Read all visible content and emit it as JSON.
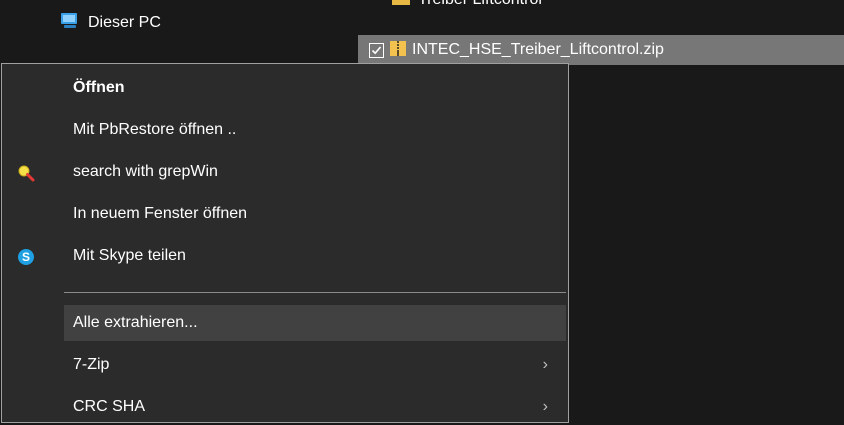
{
  "navigation": {
    "this_pc_label": "Dieser PC"
  },
  "files": {
    "previous_row_label": "Treiber Liftcontrol",
    "selected_file_name": "INTEC_HSE_Treiber_Liftcontrol.zip"
  },
  "context_menu": {
    "items": [
      {
        "label": "Öffnen"
      },
      {
        "label": "Mit PbRestore öffnen .."
      },
      {
        "label": "search with grepWin"
      },
      {
        "label": "In neuem Fenster öffnen"
      },
      {
        "label": "Mit Skype teilen"
      },
      {
        "label": "Alle extrahieren..."
      },
      {
        "label": "7-Zip"
      },
      {
        "label": "CRC SHA"
      }
    ]
  },
  "colors": {
    "background": "#191919",
    "menu_background": "#2b2b2b",
    "hover_background": "#414141",
    "selected_row": "#777777",
    "skype_blue": "#1fa0e3"
  }
}
